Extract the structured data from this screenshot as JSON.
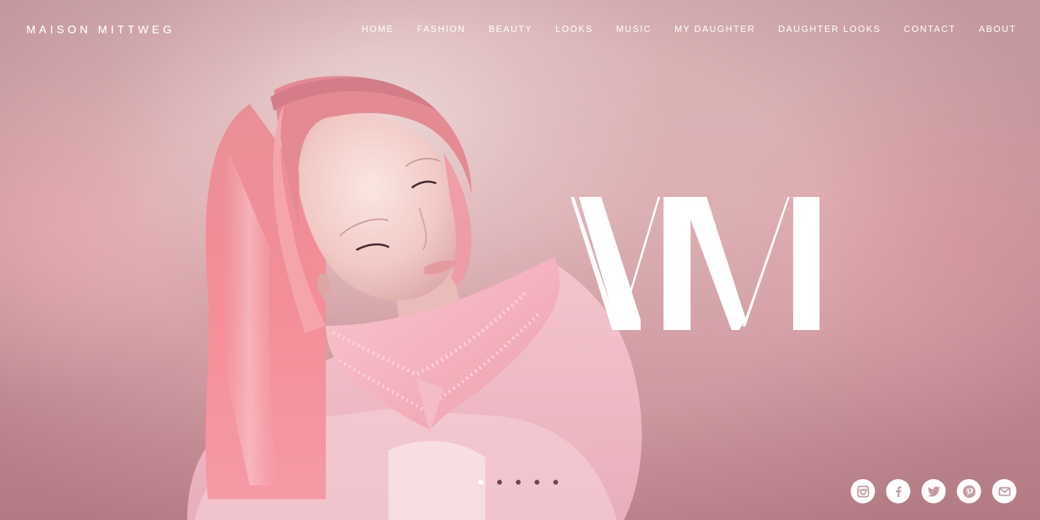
{
  "brand": {
    "name": "MAISON MITTWEG"
  },
  "nav": {
    "items": [
      {
        "label": "HOME"
      },
      {
        "label": "FASHION"
      },
      {
        "label": "BEAUTY"
      },
      {
        "label": "LOOKS"
      },
      {
        "label": "MUSIC"
      },
      {
        "label": "MY DAUGHTER"
      },
      {
        "label": "DAUGHTER LOOKS"
      },
      {
        "label": "CONTACT"
      },
      {
        "label": "ABOUT"
      }
    ]
  },
  "hero": {
    "monogram": "MM",
    "slides": {
      "count": 5,
      "active_index": 0
    }
  },
  "social": {
    "icons": [
      "instagram-icon",
      "facebook-icon",
      "twitter-icon",
      "pinterest-icon",
      "mail-icon"
    ],
    "icon_color": "#c99aa3"
  },
  "colors": {
    "background": "#d8b0b4",
    "text": "#ffffff",
    "hair": "#f08c98",
    "blouse": "#f4c4cc"
  }
}
